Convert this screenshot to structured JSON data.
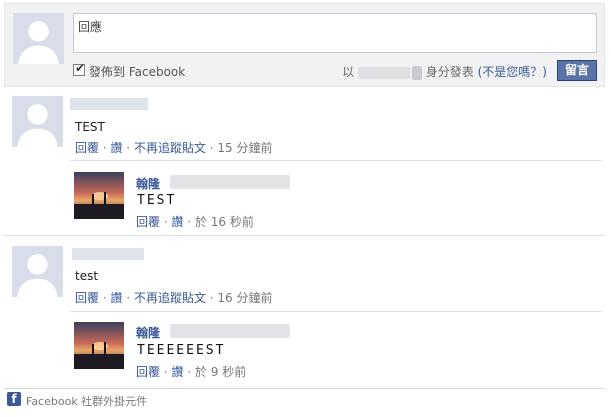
{
  "composer": {
    "placeholder": "回應",
    "checkbox_label": "發佈到 Facebook",
    "post_as_prefix": "以",
    "post_as_suffix": "身分發表",
    "not_you": "(不是您嗎？)",
    "submit": "留言"
  },
  "comments": [
    {
      "text": "TEST",
      "actions": [
        "回覆",
        "讚",
        "不再追蹤貼文"
      ],
      "time": "15 分鐘前",
      "reply": {
        "name": "翰隆",
        "text": "TEST",
        "actions": [
          "回覆",
          "讚"
        ],
        "time": "於 16 秒前"
      }
    },
    {
      "text": "test",
      "actions": [
        "回覆",
        "讚",
        "不再追蹤貼文"
      ],
      "time": "16 分鐘前",
      "reply": {
        "name": "翰隆",
        "text": "TEEEEEEST",
        "actions": [
          "回覆",
          "讚"
        ],
        "time": "於 9 秒前"
      }
    }
  ],
  "footer": {
    "text": "Facebook 社群外掛元件"
  },
  "colors": {
    "link": "#3b5998",
    "button": "#5b74a8",
    "avatar_bg": "#d8dde9"
  }
}
